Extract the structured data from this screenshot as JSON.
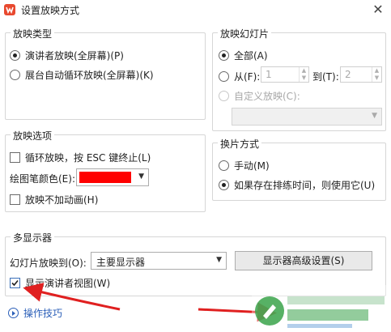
{
  "window": {
    "title": "设置放映方式",
    "close_label": "✕"
  },
  "show_type": {
    "title": "放映类型",
    "options": [
      {
        "label": "演讲者放映(全屏幕)(P)",
        "selected": true
      },
      {
        "label": "展台自动循环放映(全屏幕)(K)",
        "selected": false
      }
    ]
  },
  "show_slides": {
    "title": "放映幻灯片",
    "all_label": "全部(A)",
    "from_label": "从(F):",
    "from_value": "1",
    "to_label": "到(T):",
    "to_value": "2",
    "custom_label": "自定义放映(C):"
  },
  "show_options": {
    "title": "放映选项",
    "loop_label": "循环放映，按 ESC 键终止(L)",
    "pen_color_label": "绘图笔颜色(E):",
    "pen_color": "#ff0000",
    "no_animation_label": "放映不加动画(H)"
  },
  "advance": {
    "title": "换片方式",
    "manual_label": "手动(M)",
    "timing_label": "如果存在排练时间，则使用它(U)"
  },
  "multi_monitor": {
    "title": "多显示器",
    "show_on_label": "幻灯片放映到(O):",
    "monitor_value": "主要显示器",
    "advanced_button": "显示器高级设置(S)",
    "presenter_view_label": "显示演讲者视图(W)",
    "presenter_view_checked": true
  },
  "footer": {
    "tips_label": "操作技巧"
  },
  "colors": {
    "arrow": "#e02020",
    "accent": "#2b5fb8"
  }
}
